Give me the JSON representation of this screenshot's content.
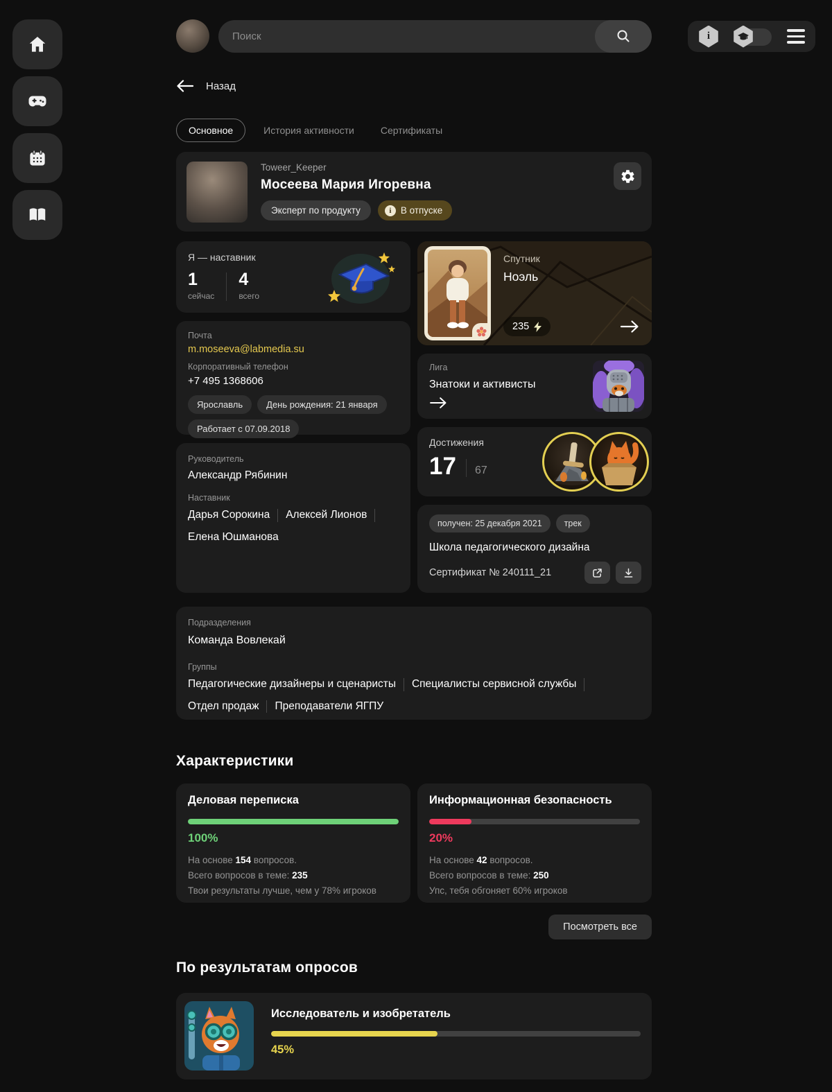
{
  "topbar": {
    "search_placeholder": "Поиск"
  },
  "nav": {
    "back_label": "Назад"
  },
  "tabs": {
    "main": "Основное",
    "activity": "История активности",
    "certificates": "Сертификаты"
  },
  "profile": {
    "nickname": "Toweer_Keeper",
    "full_name": "Мосеева  Мария Игоревна",
    "role_badge": "Эксперт по продукту",
    "status_badge": "В отпуске"
  },
  "mentor_card": {
    "title": "Я — наставник",
    "current_value": "1",
    "current_label": "сейчас",
    "total_value": "4",
    "total_label": "всего"
  },
  "contact_card": {
    "email_label": "Почта",
    "email": "m.moseeva@labmedia.su",
    "phone_label": "Корпоративный телефон",
    "phone": "+7 495 1368606",
    "tags": [
      "Ярославль",
      "День рождения: 21 января",
      "Работает с 07.09.2018"
    ]
  },
  "team_card": {
    "manager_label": "Руководитель",
    "manager_name": "Александр Рябинин",
    "mentor_label": "Наставник",
    "mentors": [
      "Дарья Сорокина",
      "Алексей Лионов",
      "Елена Юшманова"
    ]
  },
  "companion_card": {
    "label": "Спутник",
    "name": "Ноэль",
    "energy": "235"
  },
  "league_card": {
    "label": "Лига",
    "name": "Знатоки и активисты"
  },
  "achievements_card": {
    "label": "Достижения",
    "earned": "17",
    "total": "67"
  },
  "certificate_card": {
    "received_badge": "получен: 25 декабря 2021",
    "track_badge": "трек",
    "title": "Школа педагогического дизайна",
    "number": "Сертификат № 240111_21"
  },
  "departments_card": {
    "label": "Подразделения",
    "department": "Команда Вовлекай",
    "groups_label": "Группы",
    "groups": [
      "Педагогические дизайнеры и сценаристы",
      "Специалисты сервисной службы",
      "Отдел продаж",
      "Преподаватели ЯГПУ"
    ]
  },
  "characteristics": {
    "title": "Характеристики",
    "view_all_label": "Посмотреть все",
    "cards": [
      {
        "title": "Деловая переписка",
        "percent": 100,
        "percent_label": "100%",
        "color": "#6ed178",
        "based_prefix": "На основе",
        "based_value": "154",
        "based_suffix": "вопросов.",
        "total_prefix": "Всего вопросов в теме:",
        "total_value": "235",
        "note": "Твои результаты лучше, чем у 78% игроков"
      },
      {
        "title": "Информационная безопасность",
        "percent": 20,
        "percent_label": "20%",
        "color": "#ee3a5d",
        "based_prefix": "На основе",
        "based_value": "42",
        "based_suffix": "вопросов.",
        "total_prefix": "Всего вопросов в теме:",
        "total_value": "250",
        "note": "Упс, тебя обгоняет 60% игроков"
      }
    ]
  },
  "surveys": {
    "title": "По результатам опросов",
    "card": {
      "title": "Исследователь и изобретатель",
      "percent": 45,
      "percent_label": "45%",
      "color": "#e7d44e"
    }
  }
}
